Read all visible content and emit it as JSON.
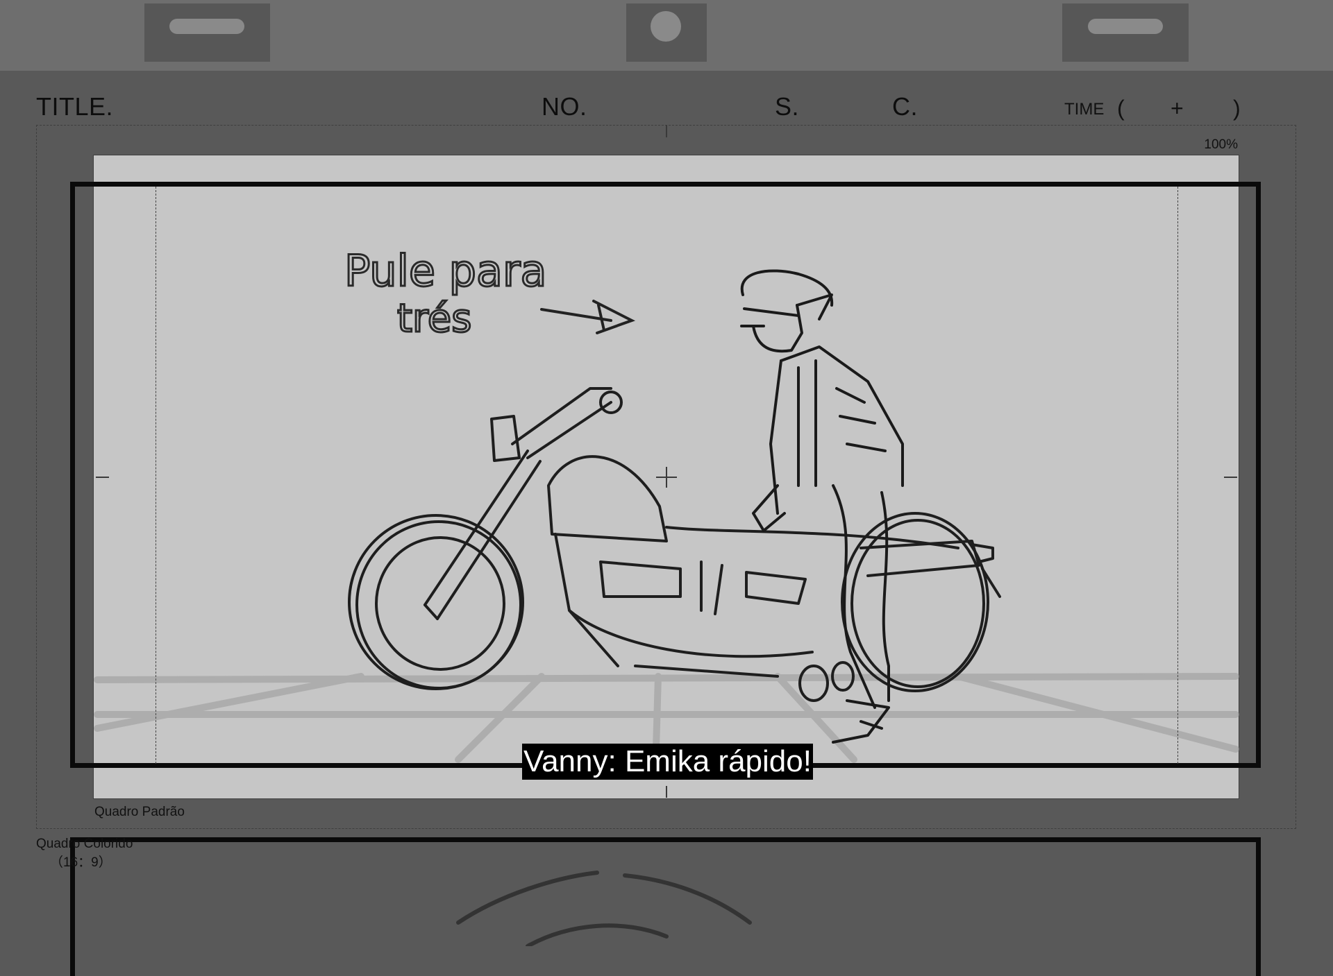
{
  "header": {
    "title_label": "TITLE.",
    "no_label": "NO.",
    "s_label": "S.",
    "c_label": "C.",
    "time_label": "TIME",
    "time_open": "(",
    "time_plus": "+",
    "time_close": ")"
  },
  "canvas": {
    "zoom": "100%",
    "frame_label": "Quadro Padrão",
    "subtitle": "Vanny: Emika rápido!",
    "sketch_note_line1": "Pule para",
    "sketch_note_line2": "trés"
  },
  "next_panel": {
    "frame_label_line1": "Quadro Colorido",
    "frame_label_line2": "（16：9）"
  },
  "colors": {
    "background": "#595959",
    "topbar": "#6e6e6e",
    "panel": "#c6c6c6",
    "subtitle_bg": "#000000",
    "subtitle_text": "#ffffff"
  }
}
